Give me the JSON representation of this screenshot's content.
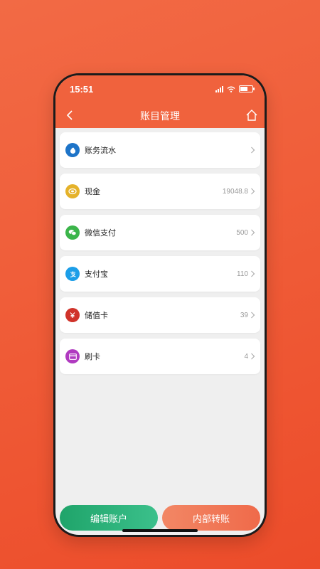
{
  "status": {
    "time": "15:51"
  },
  "nav": {
    "title": "账目管理",
    "back_icon": "chevron-left-icon",
    "home_icon": "home-icon"
  },
  "accounts": [
    {
      "label": "账务流水",
      "value": "",
      "icon": "money-bag-icon",
      "color": "#1e74c8"
    },
    {
      "label": "现金",
      "value": "19048.8",
      "icon": "cash-icon",
      "color": "#e5b22a"
    },
    {
      "label": "微信支付",
      "value": "500",
      "icon": "wechat-icon",
      "color": "#3bb54a"
    },
    {
      "label": "支付宝",
      "value": "110",
      "icon": "alipay-icon",
      "color": "#1c9ee8"
    },
    {
      "label": "储值卡",
      "value": "39",
      "icon": "yuan-card-icon",
      "color": "#d0332a"
    },
    {
      "label": "刷卡",
      "value": "4",
      "icon": "credit-card-icon",
      "color": "#b03ac0"
    }
  ],
  "bottom": {
    "edit_label": "编辑账户",
    "transfer_label": "内部转账"
  },
  "colors": {
    "brand": "#f0623d",
    "edit": "#1fa46a",
    "transfer": "#ef6a4a"
  }
}
